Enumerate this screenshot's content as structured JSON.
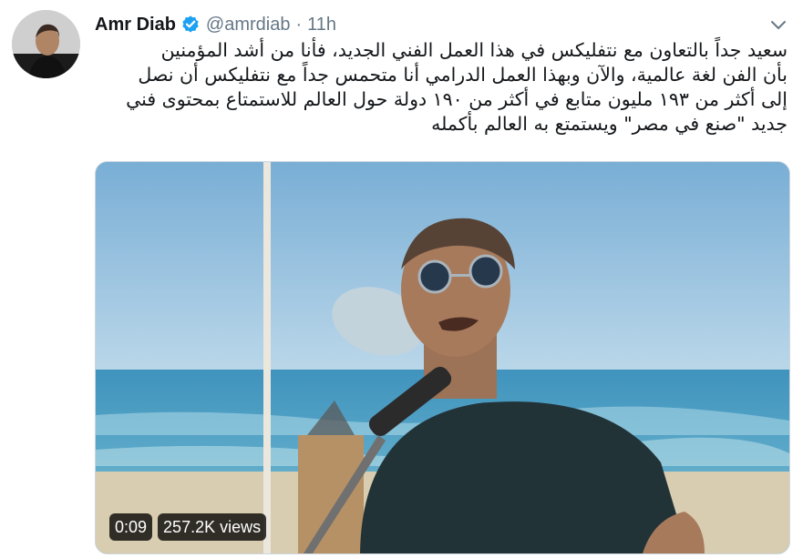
{
  "tweet": {
    "author_name": "Amr Diab",
    "handle": "@amrdiab",
    "separator": "·",
    "time": "11h",
    "text": "سعيد جداً بالتعاون مع نتفليكس في هذا العمل الفني الجديد، فأنا من أشد المؤمنين\nبأن الفن لغة عالمية، والآن وبهذا العمل الدرامي أنا متحمس جداً مع نتفليكس أن نصل\nإلى أكثر من ١٩٣ مليون متابع في أكثر من ١٩٠ دولة حول العالم للاستمتاع بمحتوى فني\nجديد \"صنع في مصر\" ويستمتع به العالم بأكمله"
  },
  "media": {
    "duration": "0:09",
    "views": "257.2K views"
  },
  "colors": {
    "verified": "#1da1f2",
    "text": "#14171a",
    "secondary": "#657786",
    "border": "#ccd6dd"
  },
  "icons": {
    "verified": "verified-badge-icon",
    "more": "chevron-down-icon"
  }
}
